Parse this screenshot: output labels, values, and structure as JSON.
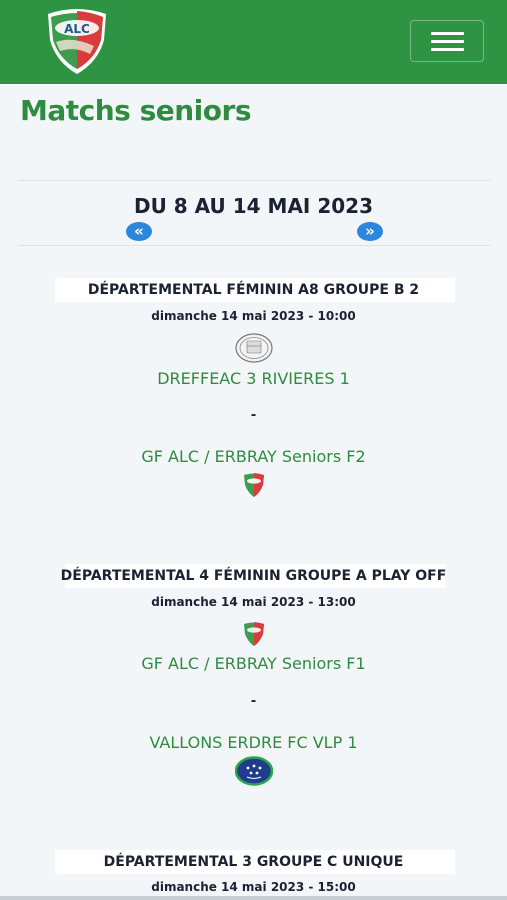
{
  "header": {
    "logo_text": "ALC",
    "menu_button": "menu"
  },
  "page": {
    "title": "Matchs seniors",
    "week": "DU 8 AU 14 MAI 2023",
    "prev_icon": "«",
    "next_icon": "»"
  },
  "matches": [
    {
      "competition": "DÉPARTEMENTAL FÉMININ A8 GROUPE B 2",
      "date": "dimanche 14 mai 2023 - 10:00",
      "home": "DREFFEAC 3 RIVIERES 1",
      "separator": "-",
      "away": "GF ALC / ERBRAY Seniors F2",
      "home_icon": "fc-dreffeac-crest-icon",
      "away_icon": "alc-shield-icon"
    },
    {
      "competition": "DÉPARTEMENTAL 4 FÉMININ GROUPE A PLAY OFF",
      "date": "dimanche 14 mai 2023 - 13:00",
      "home": "GF ALC / ERBRAY Seniors F1",
      "separator": "-",
      "away": "VALLONS ERDRE FC VLP 1",
      "home_icon": "alc-shield-icon",
      "away_icon": "vallons-erdre-crest-icon"
    },
    {
      "competition": "DÉPARTEMENTAL 3 GROUPE C UNIQUE",
      "date": "dimanche 14 mai 2023 - 15:00"
    }
  ],
  "colors": {
    "brand_green": "#2e9443",
    "title_green": "#2e8b3f",
    "text_dark": "#1b2333",
    "arrow_blue": "#2d86de",
    "background": "#f3f6f8"
  }
}
